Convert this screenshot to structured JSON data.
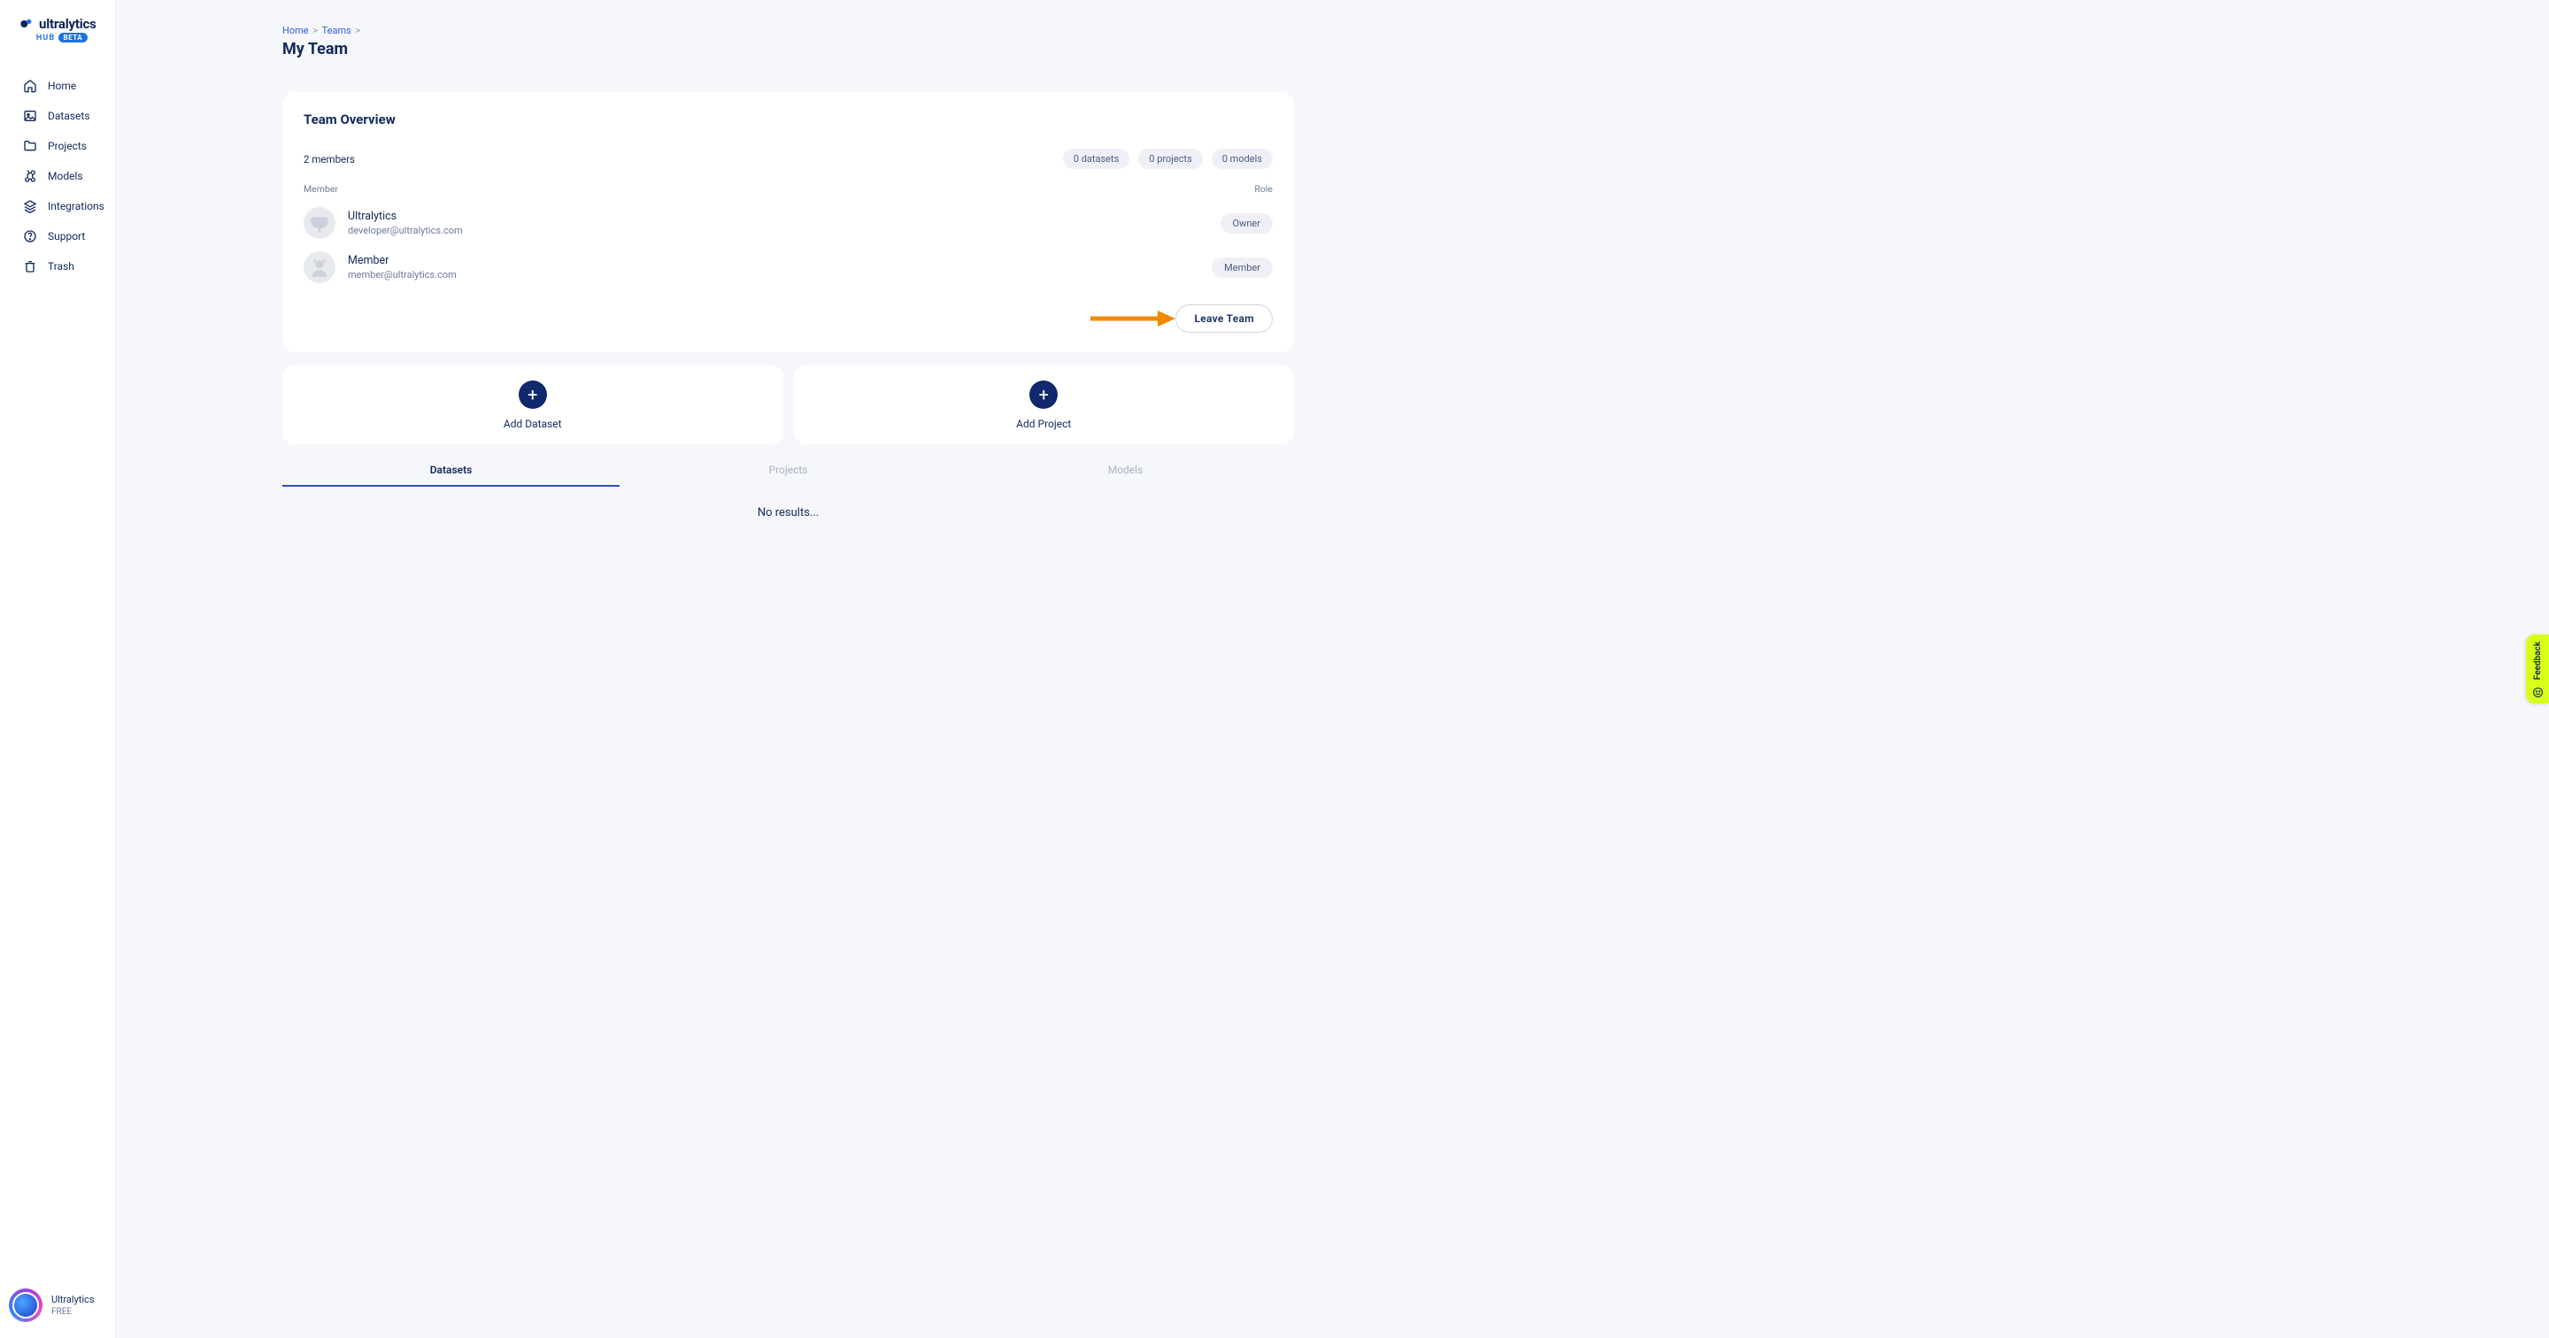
{
  "brand": {
    "name": "ultralytics",
    "hub": "HUB",
    "beta": "BETA"
  },
  "nav": {
    "home": "Home",
    "datasets": "Datasets",
    "projects": "Projects",
    "models": "Models",
    "integrations": "Integrations",
    "support": "Support",
    "trash": "Trash"
  },
  "user": {
    "name": "Ultralytics",
    "plan": "FREE"
  },
  "breadcrumb": {
    "home": "Home",
    "teams": "Teams"
  },
  "page": {
    "title": "My Team"
  },
  "overview": {
    "title": "Team Overview",
    "member_count": "2 members",
    "stats": {
      "datasets": "0 datasets",
      "projects": "0 projects",
      "models": "0 models"
    },
    "col_member": "Member",
    "col_role": "Role",
    "members": [
      {
        "name": "Ultralytics",
        "email": "developer@ultralytics.com",
        "role": "Owner"
      },
      {
        "name": "Member",
        "email": "member@ultralytics.com",
        "role": "Member"
      }
    ],
    "leave": "Leave Team"
  },
  "tiles": {
    "dataset": "Add Dataset",
    "project": "Add Project"
  },
  "tabs": {
    "datasets": "Datasets",
    "projects": "Projects",
    "models": "Models"
  },
  "results": {
    "empty": "No results..."
  },
  "feedback": "Feedback",
  "colors": {
    "accent": "#10286c",
    "highlight": "#f08a00"
  }
}
